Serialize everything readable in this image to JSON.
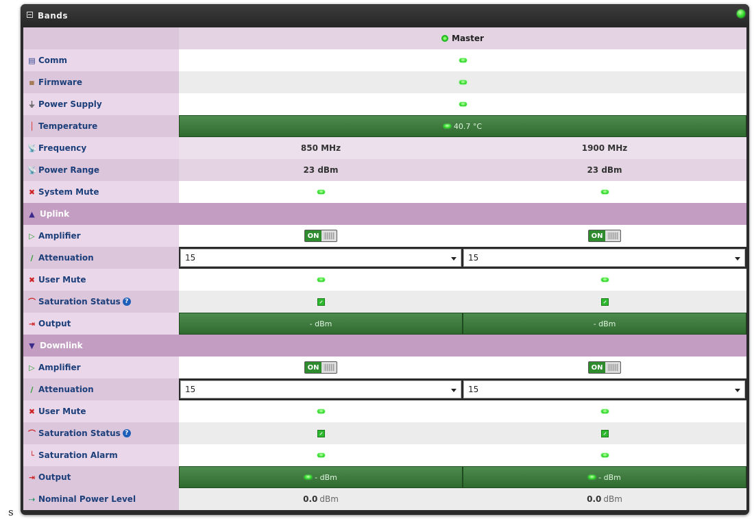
{
  "panel": {
    "title": "Bands"
  },
  "master": {
    "label": "Master"
  },
  "rows": {
    "comm": "Comm",
    "firmware": "Firmware",
    "power_supply": "Power Supply",
    "temperature": "Temperature",
    "temperature_value": "40.7 °C",
    "frequency": "Frequency",
    "frequency_b1": "850 MHz",
    "frequency_b2": "1900 MHz",
    "power_range": "Power Range",
    "power_range_b1": "23 dBm",
    "power_range_b2": "23 dBm",
    "system_mute": "System Mute"
  },
  "uplink": {
    "header": "Uplink",
    "amplifier": "Amplifier",
    "amplifier_state": "ON",
    "attenuation": "Attenuation",
    "attenuation_b1": "15",
    "attenuation_b2": "15",
    "user_mute": "User Mute",
    "saturation_status": "Saturation Status",
    "output": "Output",
    "output_b1": "- dBm",
    "output_b2": "- dBm"
  },
  "downlink": {
    "header": "Downlink",
    "amplifier": "Amplifier",
    "amplifier_state": "ON",
    "attenuation": "Attenuation",
    "attenuation_b1": "15",
    "attenuation_b2": "15",
    "user_mute": "User Mute",
    "saturation_status": "Saturation Status",
    "saturation_alarm": "Saturation Alarm",
    "output": "Output",
    "output_b1": "- dBm",
    "output_b2": "- dBm",
    "nominal_power": "Nominal Power Level",
    "nominal_b1_value": "0.0",
    "nominal_b1_unit": "dBm",
    "nominal_b2_value": "0.0",
    "nominal_b2_unit": "dBm"
  },
  "stray_char": "s",
  "colors": {
    "led_green": "#30dd2b",
    "section_band": "#c49ec2",
    "label_bg": "#ead7ea",
    "bar_green": "#3c7a3c"
  }
}
